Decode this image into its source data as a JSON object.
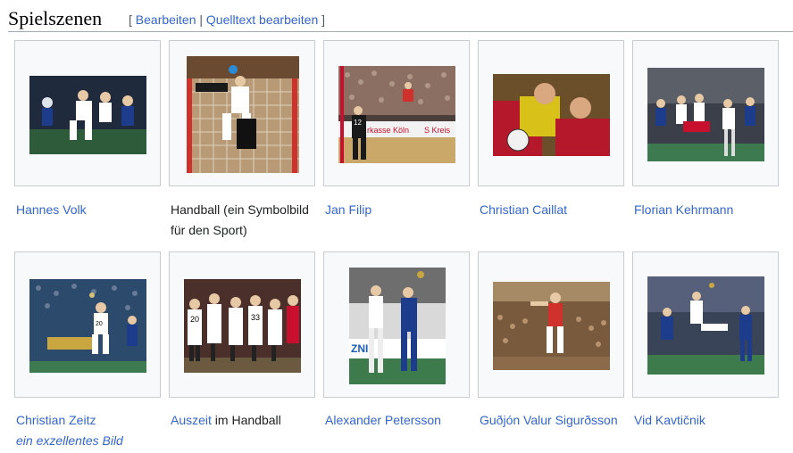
{
  "section": {
    "title": "Spielszenen",
    "edit_open": "[",
    "edit_label": "Bearbeiten",
    "edit_sep": "|",
    "source_label": "Quelltext bearbeiten",
    "edit_close": "]"
  },
  "gallery": {
    "items": [
      {
        "caption_link": "Hannes Volk",
        "caption_rest": "",
        "sub": ""
      },
      {
        "caption_link": "",
        "caption_rest": "Handball (ein Symbolbild für den Sport)",
        "sub": ""
      },
      {
        "caption_link": "Jan Filip",
        "caption_rest": "",
        "sub": ""
      },
      {
        "caption_link": "Christian Caillat",
        "caption_rest": "",
        "sub": ""
      },
      {
        "caption_link": "Florian Kehrmann",
        "caption_rest": "",
        "sub": ""
      },
      {
        "caption_link": "Christian Zeitz",
        "caption_rest": "",
        "sub": "ein exzellentes Bild"
      },
      {
        "caption_link": "Auszeit",
        "caption_rest": " im Handball",
        "sub": ""
      },
      {
        "caption_link": "Alexander Petersson",
        "caption_rest": "",
        "sub": ""
      },
      {
        "caption_link": "Guðjón Valur Sigurðsson",
        "caption_rest": "",
        "sub": ""
      },
      {
        "caption_link": "Vid Kavtičnik",
        "caption_rest": "",
        "sub": ""
      }
    ]
  },
  "photo_text": {
    "banner": "rkasse Köln",
    "banner2": "S Kreis",
    "jersey1": "12",
    "jersey2": "20",
    "jersey3": "20",
    "jersey4": "33",
    "ad": "ZNI"
  },
  "colors": {
    "link": "#3366cc",
    "text": "#202122",
    "box_bg": "#f8f9fa",
    "box_border": "#c8ccd1"
  }
}
